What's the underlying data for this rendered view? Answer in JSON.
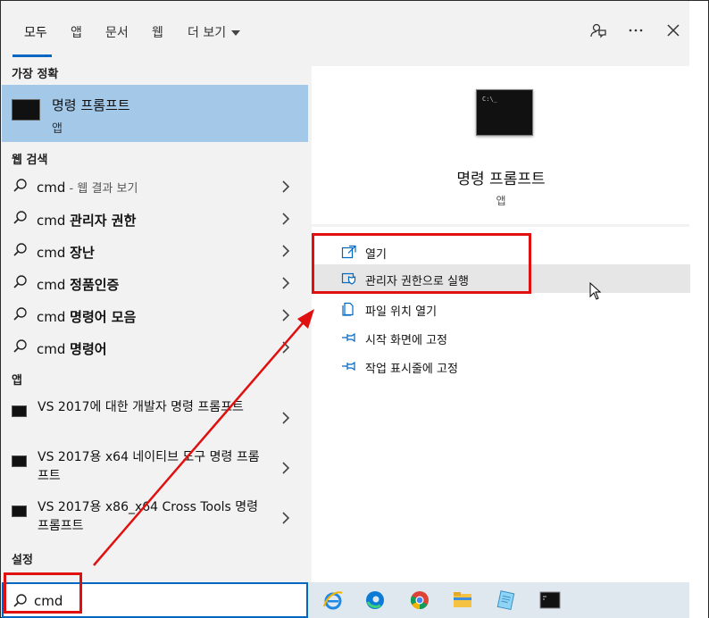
{
  "tabs": [
    {
      "label": "모두"
    },
    {
      "label": "앱"
    },
    {
      "label": "문서"
    },
    {
      "label": "웹"
    },
    {
      "label": "더 보기"
    }
  ],
  "sections": {
    "best_match": "가장 정확",
    "web_search": "웹 검색",
    "apps": "앱",
    "settings": "설정"
  },
  "best_match": {
    "title": "명령 프롬프트",
    "subtitle": "앱"
  },
  "web_results": [
    {
      "query": "cmd",
      "suffix": " - 웹 결과 보기",
      "bold": ""
    },
    {
      "query": "cmd ",
      "suffix": "",
      "bold": "관리자 권한"
    },
    {
      "query": "cmd ",
      "suffix": "",
      "bold": "장난"
    },
    {
      "query": "cmd ",
      "suffix": "",
      "bold": "정품인증"
    },
    {
      "query": "cmd ",
      "suffix": "",
      "bold": "명령어 모음"
    },
    {
      "query": "cmd ",
      "suffix": "",
      "bold": "명령어"
    }
  ],
  "app_results": [
    {
      "label": "VS 2017에 대한 개발자 명령 프롬프트"
    },
    {
      "label": "VS 2017용 x64 네이티브 도구 명령 프롬프트"
    },
    {
      "label": "VS 2017용 x86_x64 Cross Tools 명령 프롬프트"
    }
  ],
  "search": {
    "value": "cmd"
  },
  "preview": {
    "title": "명령 프롬프트",
    "subtitle": "앱"
  },
  "actions": [
    {
      "label": "열기",
      "icon": "open-icon"
    },
    {
      "label": "관리자 권한으로 실행",
      "icon": "shield-icon"
    },
    {
      "label": "파일 위치 열기",
      "icon": "file-location-icon"
    },
    {
      "label": "시작 화면에 고정",
      "icon": "pin-icon"
    },
    {
      "label": "작업 표시줄에 고정",
      "icon": "pin-icon"
    }
  ],
  "taskbar": [
    "internet-explorer-icon",
    "edge-icon",
    "chrome-icon",
    "file-explorer-icon",
    "notepad-icon",
    "cmd-icon"
  ],
  "colors": {
    "accent": "#0067c0",
    "selection": "#a4c8e8",
    "annotation": "#e01010"
  }
}
